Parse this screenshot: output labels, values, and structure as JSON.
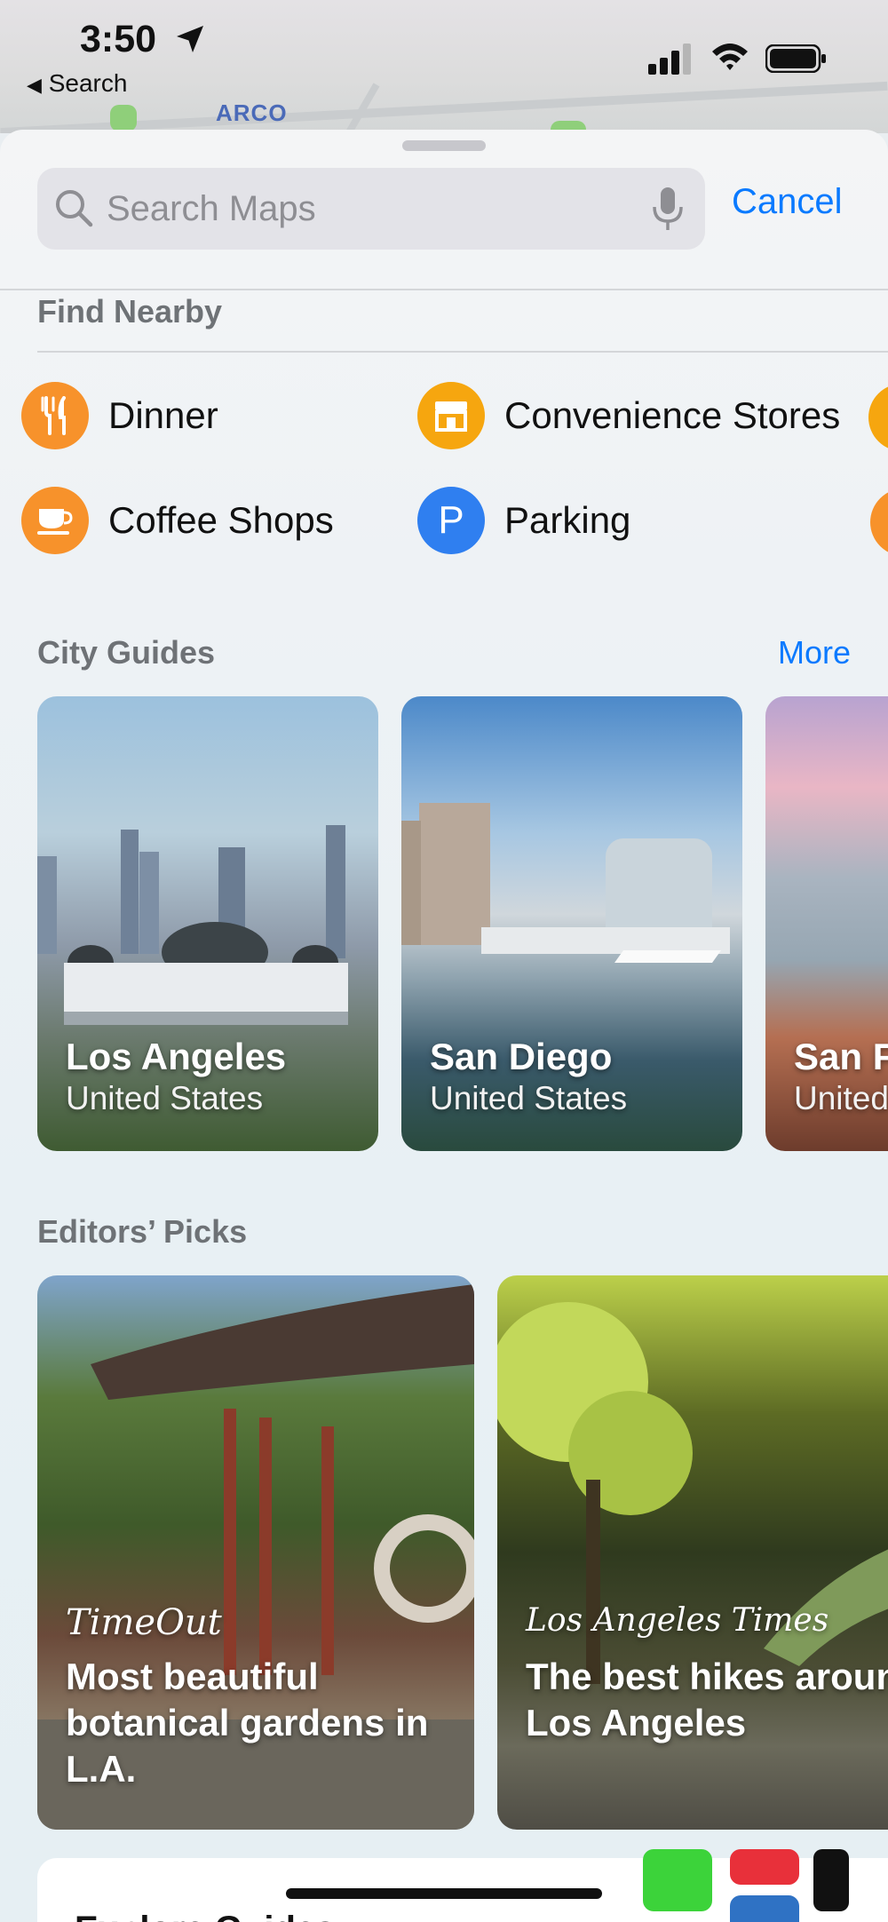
{
  "status_bar": {
    "time": "3:50",
    "back_label": "Search"
  },
  "map": {
    "label": "ARCO"
  },
  "search": {
    "placeholder": "Search Maps",
    "value": "",
    "cancel_label": "Cancel"
  },
  "find_nearby": {
    "title": "Find Nearby",
    "items": [
      {
        "label": "Dinner",
        "icon": "fork-knife-icon",
        "color": "#f7922b"
      },
      {
        "label": "Convenience Stores",
        "icon": "store-icon",
        "color": "#f6a60f"
      },
      {
        "label": "Coffee Shops",
        "icon": "coffee-cup-icon",
        "color": "#f7922b"
      },
      {
        "label": "Parking",
        "icon": "P",
        "color": "#2f7ff0"
      }
    ]
  },
  "city_guides": {
    "title": "City Guides",
    "more_label": "More",
    "cards": [
      {
        "city": "Los Angeles",
        "country": "United States"
      },
      {
        "city": "San Diego",
        "country": "United States"
      },
      {
        "city": "San F",
        "country": "United"
      }
    ]
  },
  "editors_picks": {
    "title": "Editors’ Picks",
    "cards": [
      {
        "brand": "TimeOut",
        "title": "Most beautiful botanical gardens in L.A."
      },
      {
        "brand": "Los Angeles Times",
        "title": "The best hikes around Los Angeles"
      }
    ]
  },
  "explore": {
    "title": "Explore Guides"
  }
}
